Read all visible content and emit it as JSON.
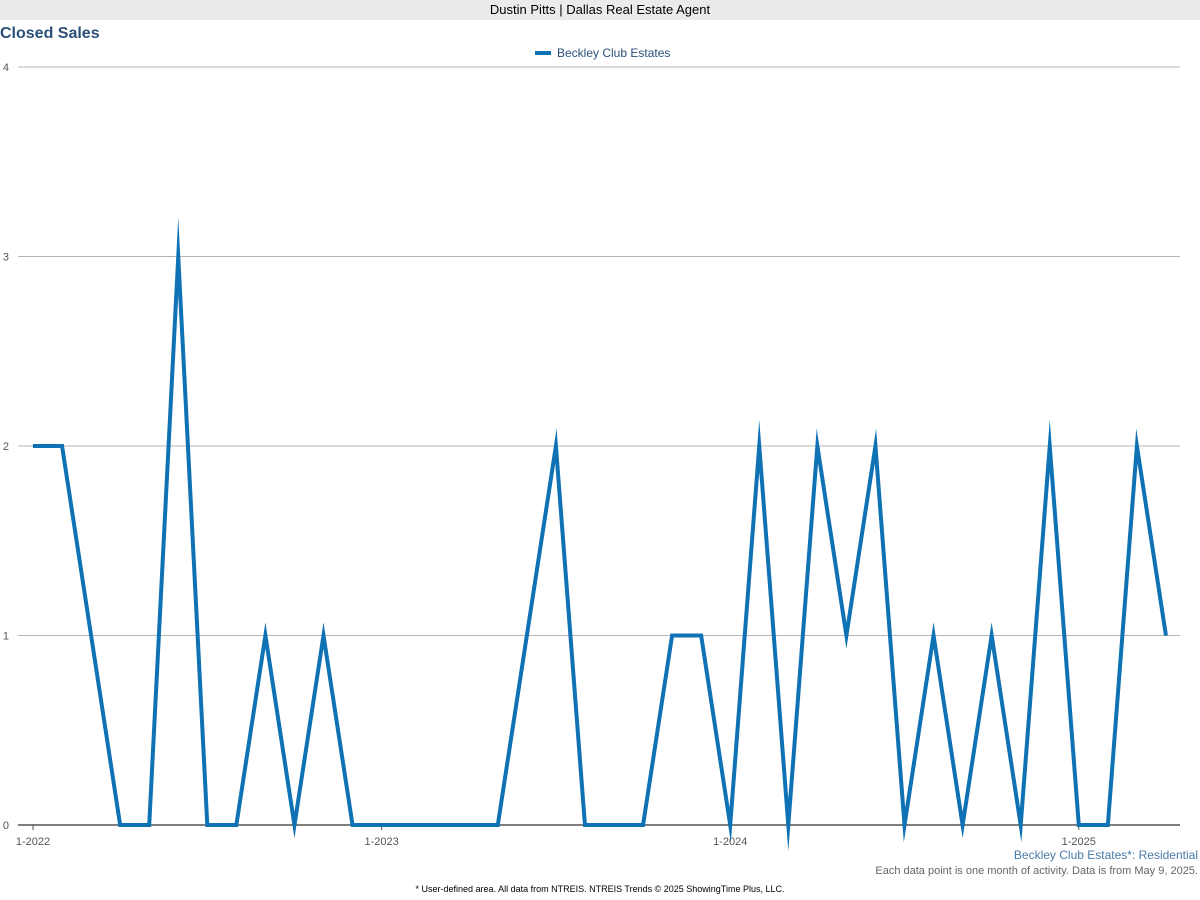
{
  "header": {
    "title": "Dustin Pitts | Dallas Real Estate Agent"
  },
  "footer": {
    "area_label": "Beckley Club Estates*: Residential",
    "activity_note": "Each data point is one month of activity. Data is from May 9, 2025.",
    "source_note": "* User-defined area. All data from NTREIS. NTREIS Trends © 2025 ShowingTime Plus, LLC."
  },
  "colors": {
    "series": "#0f72b5",
    "title": "#2b4f78",
    "grid": "#b5b5b5",
    "axis": "#555555",
    "tick_label": "#555555",
    "header_bg": "#ebebeb"
  },
  "chart_data": {
    "type": "line",
    "title": "Closed Sales",
    "legend_position": "top-center",
    "grid": true,
    "ylim": [
      0,
      4
    ],
    "y_ticks": [
      "0",
      "1",
      "2",
      "3",
      "4"
    ],
    "x_ticks": [
      "1-2022",
      "1-2023",
      "1-2024",
      "1-2025"
    ],
    "x": [
      "2022-01",
      "2022-02",
      "2022-03",
      "2022-04",
      "2022-05",
      "2022-06",
      "2022-07",
      "2022-08",
      "2022-09",
      "2022-10",
      "2022-11",
      "2022-12",
      "2023-01",
      "2023-02",
      "2023-03",
      "2023-04",
      "2023-05",
      "2023-06",
      "2023-07",
      "2023-08",
      "2023-09",
      "2023-10",
      "2023-11",
      "2023-12",
      "2024-01",
      "2024-02",
      "2024-03",
      "2024-04",
      "2024-05",
      "2024-06",
      "2024-07",
      "2024-08",
      "2024-09",
      "2024-10",
      "2024-11",
      "2024-12",
      "2025-01",
      "2025-02",
      "2025-03",
      "2025-04"
    ],
    "series": [
      {
        "name": "Beckley Club Estates",
        "values": [
          2,
          2,
          1,
          0,
          0,
          3,
          0,
          0,
          1,
          0,
          1,
          0,
          0,
          0,
          0,
          0,
          0,
          1,
          2,
          0,
          0,
          0,
          1,
          1,
          0,
          2,
          0,
          2,
          1,
          2,
          0,
          1,
          0,
          1,
          0,
          2,
          0,
          0,
          2,
          1
        ]
      }
    ]
  }
}
